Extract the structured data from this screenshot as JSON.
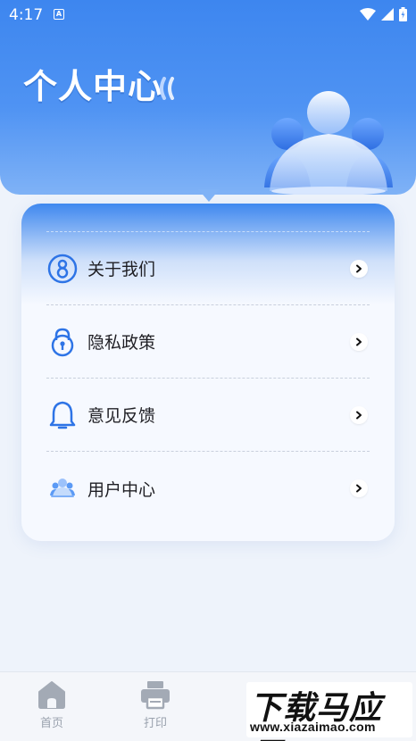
{
  "status_bar": {
    "time": "4:17",
    "notification_letter": "A",
    "icons": [
      "wifi-icon",
      "signal-icon",
      "battery-icon"
    ]
  },
  "header": {
    "title": "个人中心"
  },
  "menu": {
    "items": [
      {
        "label": "关于我们",
        "icon": "about-icon"
      },
      {
        "label": "隐私政策",
        "icon": "lock-icon"
      },
      {
        "label": "意见反馈",
        "icon": "bell-icon"
      },
      {
        "label": "用户中心",
        "icon": "users-icon"
      }
    ]
  },
  "bottom_nav": {
    "items": [
      {
        "label": "首页",
        "icon": "home-icon"
      },
      {
        "label": "打印",
        "icon": "printer-icon"
      }
    ]
  },
  "watermark": {
    "text": "下载马应用",
    "url": "www.xiazaimao.com"
  },
  "colors": {
    "header_blue": "#3d86ef",
    "icon_blue": "#2e74e6",
    "nav_gray": "#9aa2ae"
  }
}
